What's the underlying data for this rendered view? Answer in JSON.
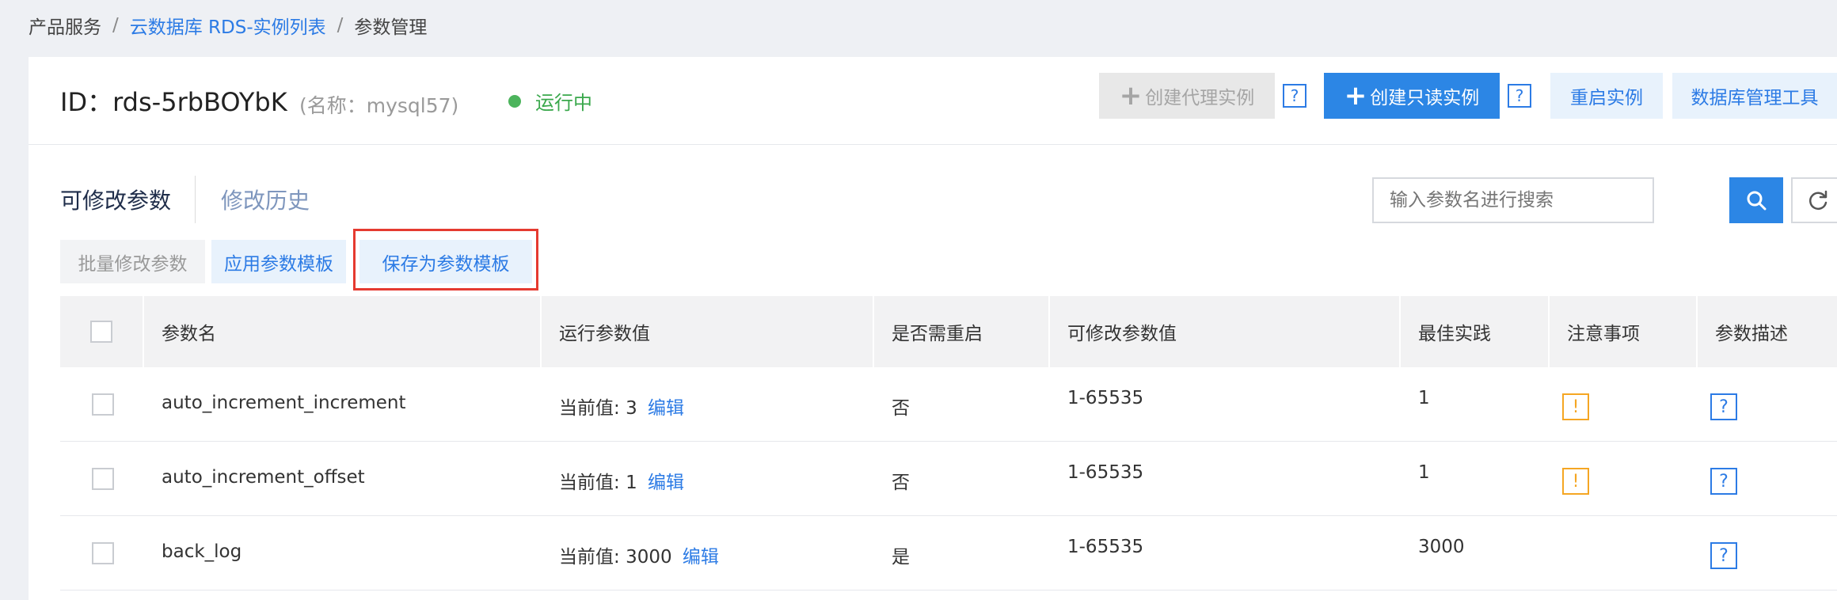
{
  "breadcrumb": {
    "item1": "产品服务",
    "sep": "/",
    "item2": "云数据库 RDS-实例列表",
    "item3": "参数管理"
  },
  "instance": {
    "id_text": "ID：rds-5rbBOYbK",
    "name_text": "(名称：mysql57)",
    "status": "运行中"
  },
  "header_buttons": {
    "create_proxy": "创建代理实例",
    "create_readonly": "创建只读实例",
    "restart": "重启实例",
    "db_tool": "数据库管理工具",
    "help": "?",
    "plus": "+"
  },
  "tabs": {
    "editable": "可修改参数",
    "history": "修改历史"
  },
  "search": {
    "placeholder": "输入参数名进行搜索"
  },
  "actions": {
    "batch_edit": "批量修改参数",
    "apply_template": "应用参数模板",
    "save_template": "保存为参数模板"
  },
  "table": {
    "headers": {
      "name": "参数名",
      "run_value": "运行参数值",
      "restart": "是否需重启",
      "range": "可修改参数值",
      "best": "最佳实践",
      "notice": "注意事项",
      "desc": "参数描述"
    },
    "current_prefix": "当前值:",
    "edit_label": "编辑",
    "warn_symbol": "!",
    "help_symbol": "?",
    "rows": [
      {
        "name": "auto_increment_increment",
        "value": "3",
        "restart": "否",
        "range": "1-65535",
        "best": "1",
        "has_warn": true
      },
      {
        "name": "auto_increment_offset",
        "value": "1",
        "restart": "否",
        "range": "1-65535",
        "best": "1",
        "has_warn": true
      },
      {
        "name": "back_log",
        "value": "3000",
        "restart": "是",
        "range": "1-65535",
        "best": "3000",
        "has_warn": false
      }
    ]
  },
  "colors": {
    "accent": "#2c86e5",
    "link": "#2c7be5",
    "status_green": "#3aa84c",
    "warn": "#f5a623",
    "highlight_red": "#e53a30"
  }
}
